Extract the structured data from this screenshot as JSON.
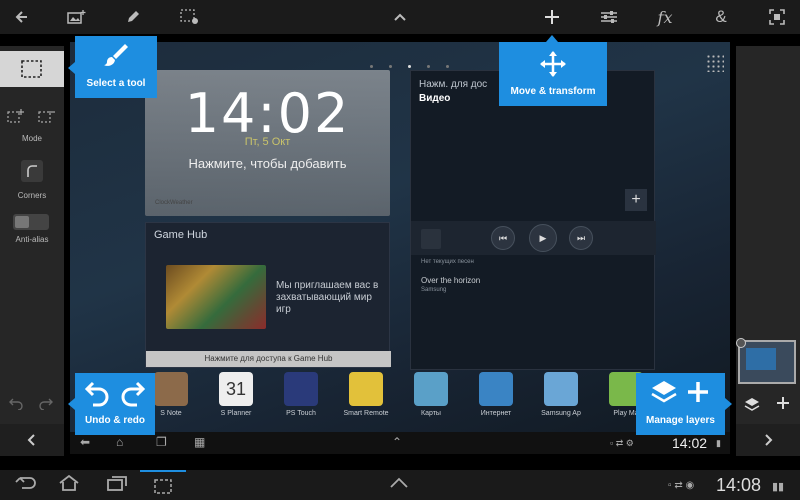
{
  "colors": {
    "tip_bg": "#1e8ee0",
    "toolbar_bg": "#1b1b1b",
    "panel_bg": "#262626"
  },
  "toolbar": {
    "icons": [
      "back-arrow-icon",
      "add-image-icon",
      "pencil-icon",
      "selection-settings-icon",
      "chevron-up-icon",
      "move-icon",
      "sliders-icon",
      "fx-icon",
      "ampersand-icon",
      "fit-screen-icon"
    ],
    "fx_label": "fx",
    "amp_label": "&"
  },
  "left_panel": {
    "mode_label": "Mode",
    "corners_label": "Corners",
    "antialias_label": "Anti-alias"
  },
  "tooltips": {
    "select_tool": "Select a tool",
    "move_transform": "Move & transform",
    "undo_redo": "Undo & redo",
    "manage_layers": "Manage layers"
  },
  "screen": {
    "clock": {
      "time": "14:02",
      "date": "Пт, 5 Окт",
      "hint": "Нажмите, чтобы добавить",
      "brand": "ClockWeather"
    },
    "gamehub": {
      "title": "Game Hub",
      "text": "Мы приглашаем вас в захватывающий мир игр",
      "bar": "Нажмите для доступа к Game Hub"
    },
    "video": {
      "line1": "Нажм. для дос",
      "line2": "Видео",
      "status": "Нет текущих песен",
      "track": "Over the horizon",
      "artist": "Samsung"
    },
    "dock": [
      {
        "label": "S Note",
        "color": "#8c6a4a"
      },
      {
        "label": "S Planner",
        "color": "#5e9a3a"
      },
      {
        "label": "PS Touch",
        "color": "#2a3a7a"
      },
      {
        "label": "Smart Remote",
        "color": "#e2c13a"
      },
      {
        "label": "Карты",
        "color": "#5aa0c8"
      },
      {
        "label": "Интернет",
        "color": "#3a84c4"
      },
      {
        "label": "Samsung Ap",
        "color": "#6aa6d6"
      },
      {
        "label": "Play Ma",
        "color": "#7ab84a"
      }
    ],
    "planner_day": "31",
    "inner_time": "14:02"
  },
  "system_bar": {
    "time": "14:08"
  }
}
